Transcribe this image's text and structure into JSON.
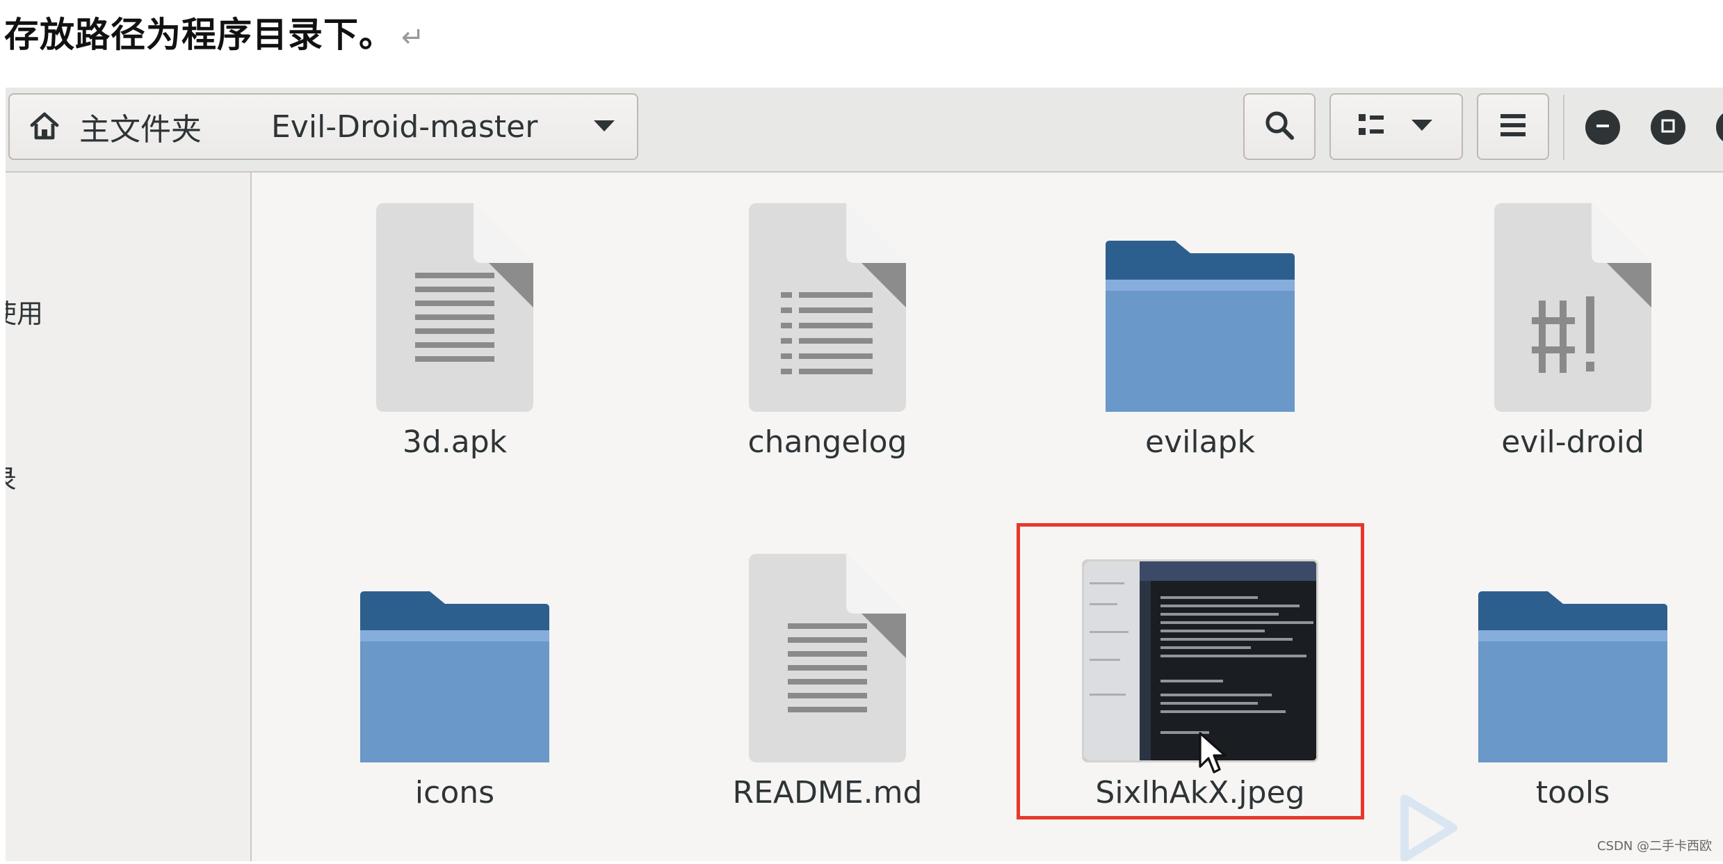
{
  "caption": {
    "text": "存放路径为程序目录下。",
    "return_mark": "↵"
  },
  "pathbar": {
    "home_label": "主文件夹",
    "current_folder": "Evil-Droid-master"
  },
  "sidebar": {
    "items": [
      "使用",
      "录"
    ]
  },
  "files": [
    {
      "name": "3d.apk",
      "icon": "text-file-icon"
    },
    {
      "name": "changelog",
      "icon": "list-file-icon"
    },
    {
      "name": "evilapk",
      "icon": "folder-icon"
    },
    {
      "name": "evil-droid",
      "icon": "script-file-icon"
    },
    {
      "name": "icons",
      "icon": "folder-icon"
    },
    {
      "name": "README.md",
      "icon": "text-file-icon"
    },
    {
      "name": "SixlhAkX.jpeg",
      "icon": "image-thumbnail",
      "highlighted": true
    },
    {
      "name": "tools",
      "icon": "folder-icon"
    }
  ],
  "colors": {
    "highlight": "#e6392c",
    "folder_tab": "#2d5f8e",
    "folder_body": "#6a98c9",
    "file_page": "#dcdcdc"
  },
  "watermark": "CSDN @二手卡西欧"
}
